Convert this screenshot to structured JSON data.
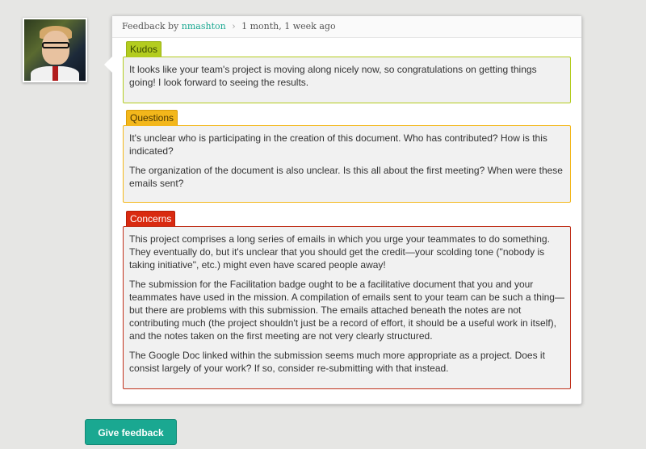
{
  "header": {
    "prefix": "Feedback by",
    "username": "nmashton",
    "separator": "›",
    "time": "1 month, 1 week ago"
  },
  "sections": {
    "kudos": {
      "label": "Kudos",
      "paragraphs": [
        "It looks like your team's project is moving along nicely now, so congratulations on getting things going! I look forward to seeing the results."
      ]
    },
    "questions": {
      "label": "Questions",
      "paragraphs": [
        "It's unclear who is participating in the creation of this document. Who has contributed? How is this indicated?",
        "The organization of the document is also unclear. Is this all about the first meeting? When were these emails sent?"
      ]
    },
    "concerns": {
      "label": "Concerns",
      "paragraphs": [
        "This project comprises a long series of emails in which you urge your teammates to do something. They eventually do, but it's unclear that you should get the credit—your scolding tone (\"nobody is taking initiative\", etc.) might even have scared people away!",
        "The submission for the Facilitation badge ought to be a facilitative document that you and your teammates have used in the mission. A compilation of emails sent to your team can be such a thing—but there are problems with this submission. The emails attached beneath the notes are not contributing much (the project shouldn't just be a record of effort, it should be a useful work in itself), and the notes taken on the first meeting are not very clearly structured.",
        "The Google Doc linked within the submission seems much more appropriate as a project. Does it consist largely of your work? If so, consider re-submitting with that instead."
      ]
    }
  },
  "actions": {
    "give_feedback": "Give feedback"
  },
  "colors": {
    "accent": "#1aa891",
    "kudos": "#b3cc1f",
    "questions": "#f3b71b",
    "concerns": "#d92a10"
  }
}
